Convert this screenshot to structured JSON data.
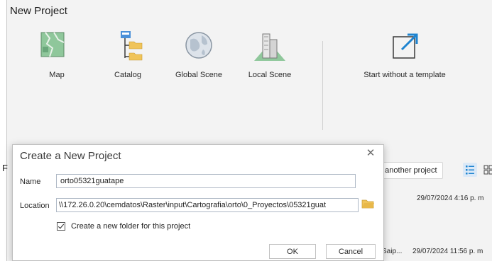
{
  "window": {
    "title": "New Project"
  },
  "tiles": [
    {
      "label": "Map",
      "icon": "map-icon"
    },
    {
      "label": "Catalog",
      "icon": "catalog-icon"
    },
    {
      "label": "Global Scene",
      "icon": "globe-icon"
    },
    {
      "label": "Local Scene",
      "icon": "local-scene-icon"
    },
    {
      "label": "Start without a template",
      "icon": "open-arrow-icon"
    }
  ],
  "background": {
    "cut_letter": "F",
    "another_project": "n another project",
    "rows": [
      {
        "date": "29/07/2024 4:16 p. m"
      },
      {
        "partial": "Saip...",
        "date": "29/07/2024 11:56 p. m"
      }
    ]
  },
  "dialog": {
    "title": "Create a New Project",
    "name_label": "Name",
    "name_value": "orto05321guatape",
    "location_label": "Location",
    "location_value": "\\\\172.26.0.20\\cemdatos\\Raster\\input\\Cartografia\\orto\\0_Proyectos\\05321guat",
    "checkbox_label": "Create a new folder for this project",
    "checkbox_checked": true,
    "ok_label": "OK",
    "cancel_label": "Cancel"
  },
  "colors": {
    "accent": "#1e84d0",
    "folder": "#e8b84a",
    "map_green": "#7cb489"
  }
}
